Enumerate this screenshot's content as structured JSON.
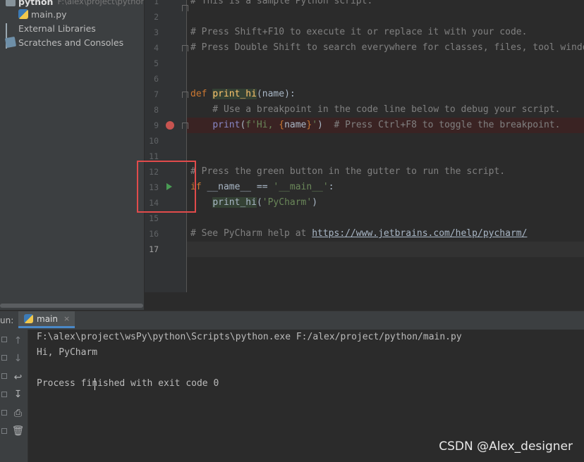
{
  "project_tree": {
    "root_label": "python",
    "root_path": "F:\\alex\\project\\python",
    "file": "main.py",
    "external_libraries": "External Libraries",
    "scratches": "Scratches and Consoles"
  },
  "editor": {
    "line_numbers": [
      "1",
      "2",
      "3",
      "4",
      "5",
      "6",
      "7",
      "8",
      "9",
      "10",
      "11",
      "12",
      "13",
      "14",
      "15",
      "16",
      "17"
    ],
    "line1": "# This is a sample Python script.",
    "line3": "# Press Shift+F10 to execute it or replace it with your code.",
    "line4": "# Press Double Shift to search everywhere for classes, files, tool windows, actions, and settings.",
    "line7_kw": "def",
    "line7_fn": "print_hi",
    "line7_rest": "(name):",
    "line8": "    # Use a breakpoint in the code line below to debug your script.",
    "line9_builtin": "print",
    "line9_open": "(",
    "line9_fpre": "f'Hi, ",
    "line9_lbrace": "{",
    "line9_var": "name",
    "line9_rbrace": "}",
    "line9_fpost": "'",
    "line9_close": ")  ",
    "line9_comment": "# Press Ctrl+F8 to toggle the breakpoint.",
    "line12": "# Press the green button in the gutter to run the script.",
    "line13_kw": "if",
    "line13_mid": " __name__ == ",
    "line13_str": "'__main__'",
    "line13_colon": ":",
    "line14_fn": "print_hi",
    "line14_open": "(",
    "line14_str": "'PyCharm'",
    "line14_close": ")",
    "line16_comment": "# See PyCharm help at ",
    "line16_link": "https://www.jetbrains.com/help/pycharm/"
  },
  "run_panel": {
    "prefix": "un:",
    "tab_label": "main",
    "tab_close": "×",
    "toolbar_icons": [
      "arrow-up-icon",
      "arrow-down-icon",
      "soft-wrap-icon",
      "scroll-to-end-icon",
      "print-icon",
      "trash-icon"
    ]
  },
  "console": {
    "line1": "F:\\alex\\project\\wsPy\\python\\Scripts\\python.exe F:/alex/project/python/main.py",
    "line2": "Hi, PyCharm",
    "line4": "Process finished with exit code 0"
  },
  "watermark": "CSDN @Alex_designer",
  "colors": {
    "keyword": "#cc7832",
    "function": "#ffc66d",
    "string": "#6a8759",
    "comment": "#808080",
    "breakpoint": "#c75450",
    "run_arrow": "#499c54",
    "highlight_box": "#e14b4b"
  }
}
